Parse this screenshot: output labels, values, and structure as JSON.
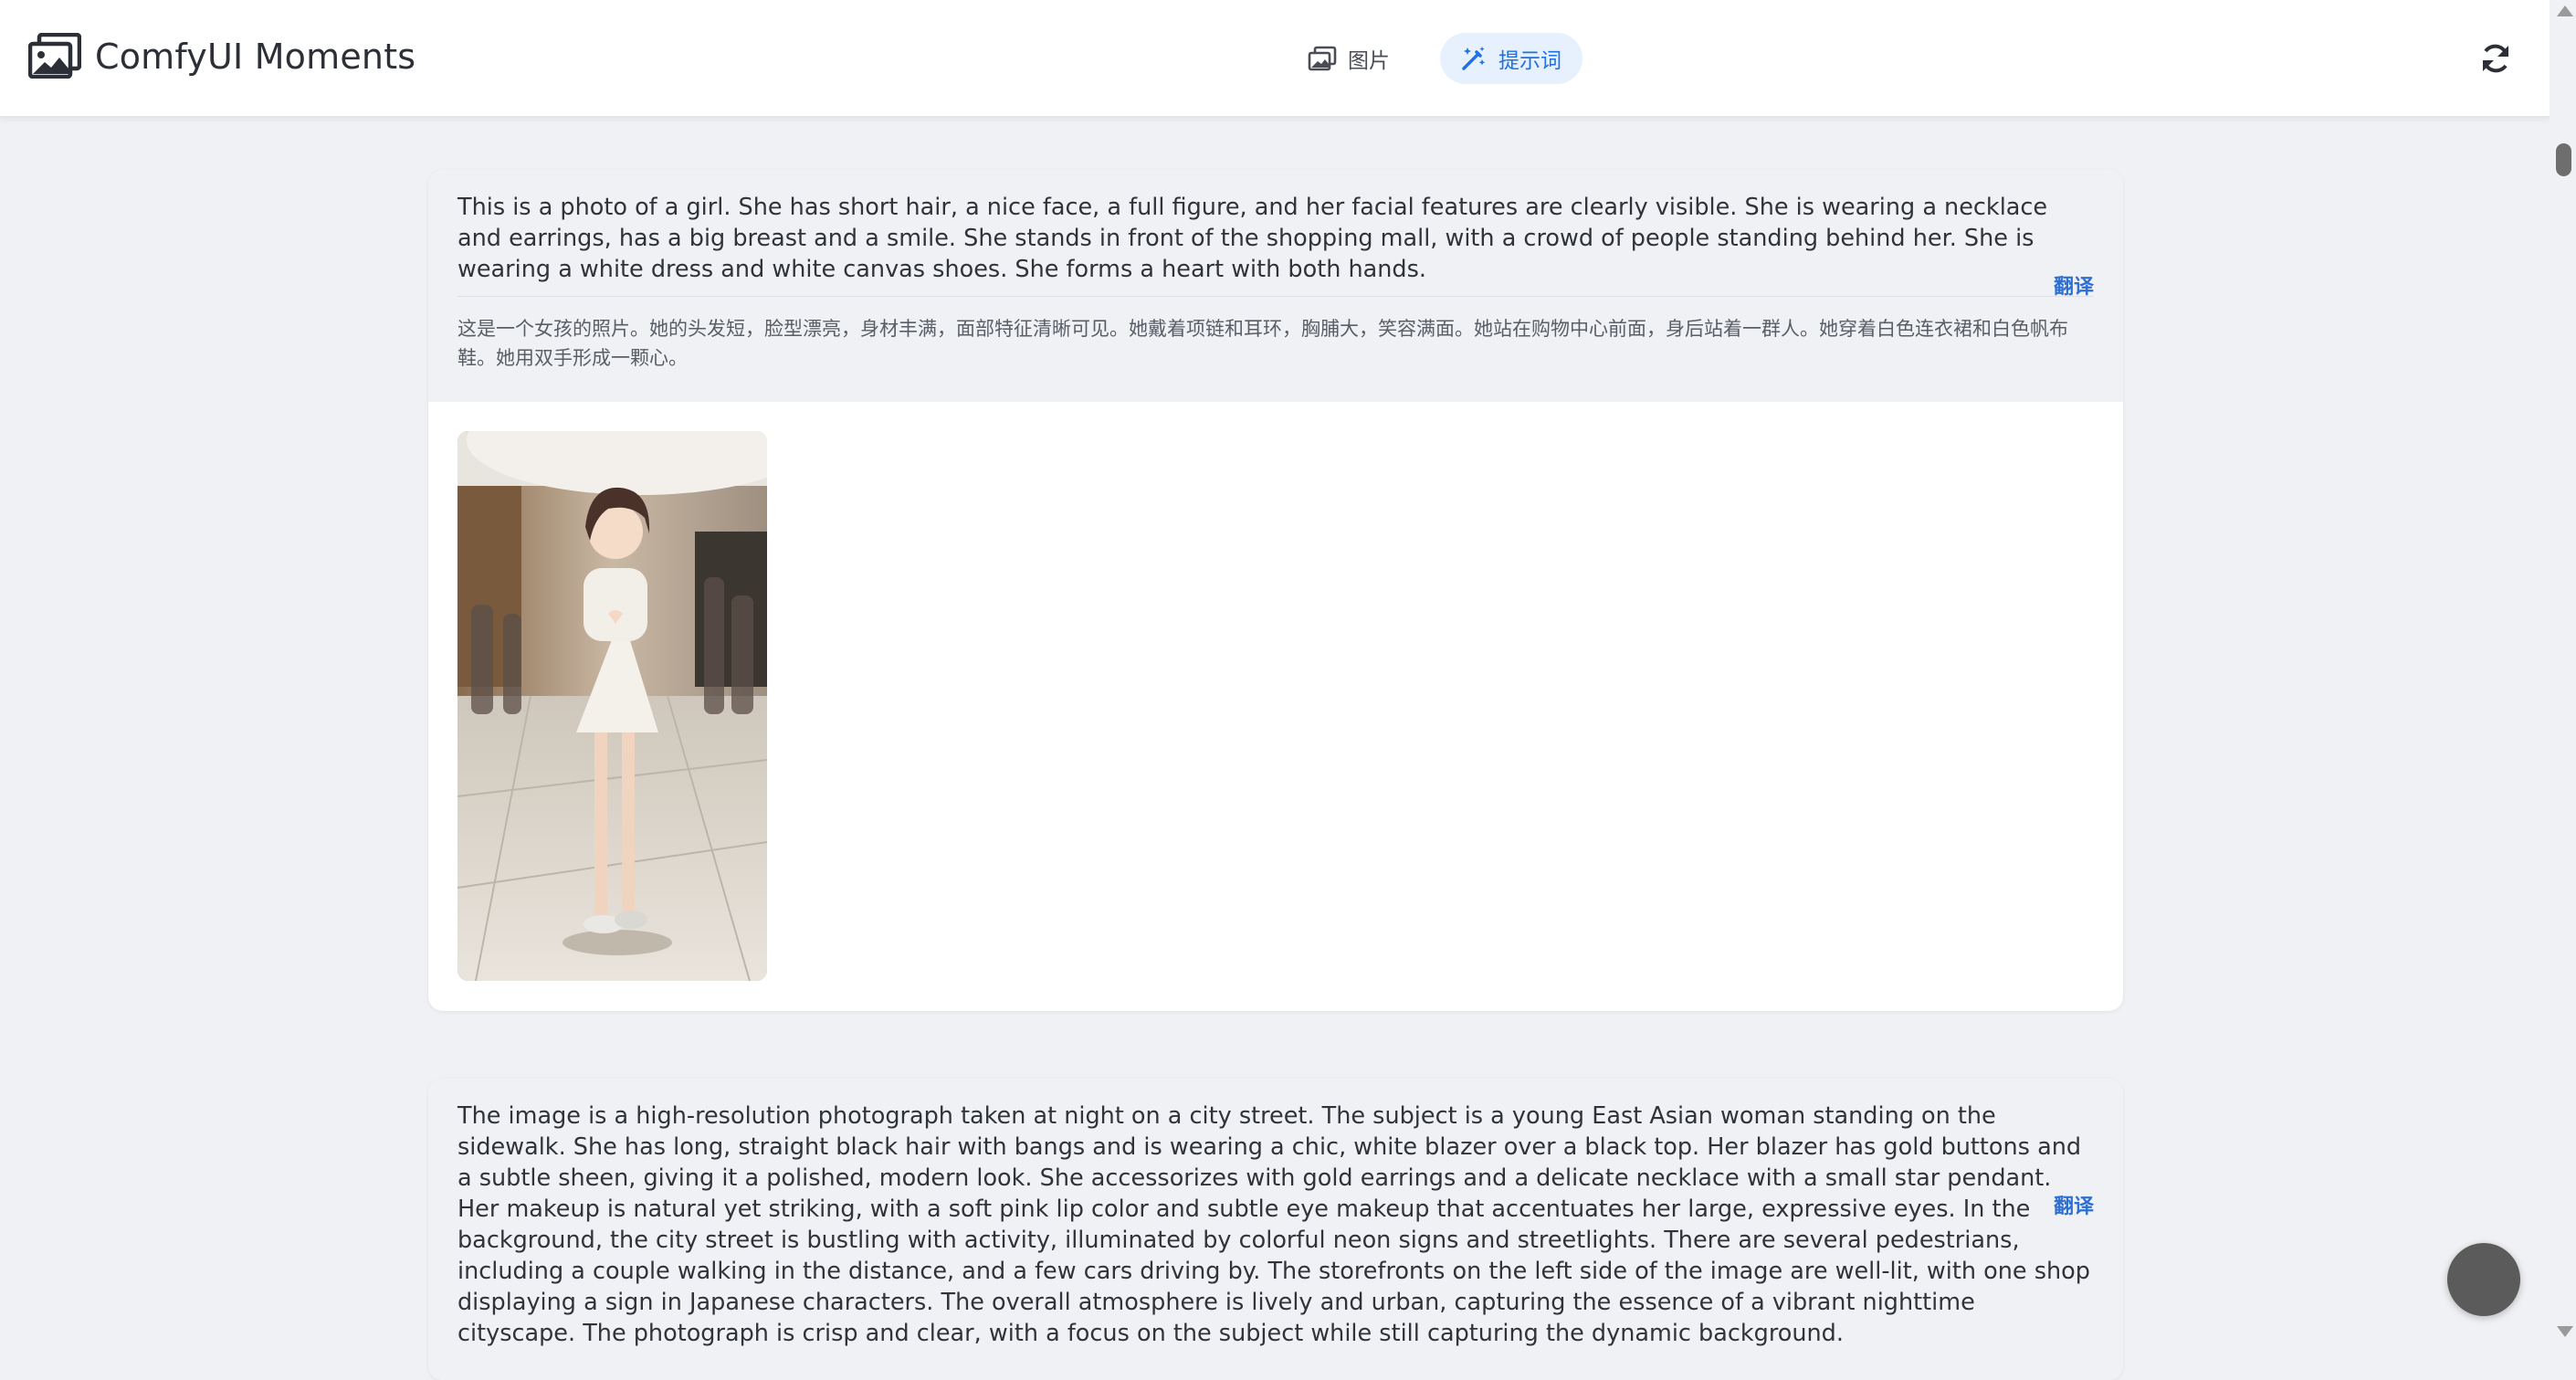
{
  "app": {
    "title": "ComfyUI Moments"
  },
  "tabs": [
    {
      "label": "图片",
      "active": false
    },
    {
      "label": "提示词",
      "active": true
    }
  ],
  "colors": {
    "accent": "#1f6fe5",
    "tab_active_bg": "#e6f1fd",
    "page_bg": "#f0f1f4",
    "link": "#2f6fd2"
  },
  "icons": {
    "logo": "images-icon",
    "tab_images": "image-icon",
    "tab_prompts": "magic-wand-icon",
    "refresh": "refresh-icon"
  },
  "prompts": [
    {
      "text_en": "This is a photo of a girl. She has short hair, a nice face, a full figure, and her facial features are clearly visible. She is wearing a necklace and earrings, has a big breast and a smile. She stands in front of the shopping mall, with a crowd of people standing behind her. She is wearing a white dress and white canvas shoes. She forms a heart with both hands.",
      "translate_label": "翻译",
      "text_zh": "这是一个女孩的照片。她的头发短，脸型漂亮，身材丰满，面部特征清晰可见。她戴着项链和耳环，胸脯大，笑容满面。她站在购物中心前面，身后站着一群人。她穿着白色连衣裙和白色帆布鞋。她用双手形成一颗心。"
    },
    {
      "text_en": "The image is a high-resolution photograph taken at night on a city street. The subject is a young East Asian woman standing on the sidewalk. She has long, straight black hair with bangs and is wearing a chic, white blazer over a black top. Her blazer has gold buttons and a subtle sheen, giving it a polished, modern look. She accessorizes with gold earrings and a delicate necklace with a small star pendant. Her makeup is natural yet striking, with a soft pink lip color and subtle eye makeup that accentuates her large, expressive eyes. In the background, the city street is bustling with activity, illuminated by colorful neon signs and streetlights. There are several pedestrians, including a couple walking in the distance, and a few cars driving by. The storefronts on the left side of the image are well-lit, with one shop displaying a sign in Japanese characters. The overall atmosphere is lively and urban, capturing the essence of a vibrant nighttime cityscape. The photograph is crisp and clear, with a focus on the subject while still capturing the dynamic background.",
      "translate_label": "翻译"
    }
  ]
}
